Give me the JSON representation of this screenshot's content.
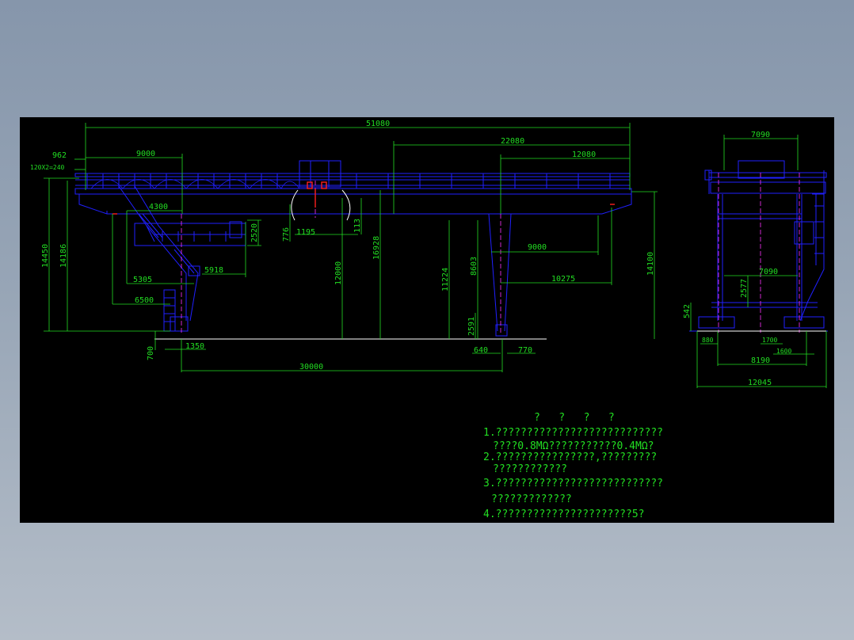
{
  "drawing": {
    "colors": {
      "structure": "#2020ff",
      "dimension": "#22dd22",
      "center_line": "#ff33ff",
      "hook": "#ff2020",
      "ground": "#ffffff",
      "background": "#000000"
    },
    "front_view_dims": {
      "d51080": "51080",
      "d22080": "22080",
      "d12080": "12080",
      "d962": "962",
      "d9000_top": "9000",
      "d120x2": "120X2=240",
      "d4300": "4300",
      "d2520": "2520",
      "d776": "776",
      "d1195": "1195",
      "d113": "113",
      "d16928": "16928",
      "d12000": "12000",
      "d11224": "11224",
      "d8603": "8603",
      "d2591": "2591",
      "d9000_right": "9000",
      "d10275": "10275",
      "d14100": "14100",
      "d14450": "14450",
      "d14186": "14186",
      "d5305": "5305",
      "d5918": "5918",
      "d6500": "6500",
      "d700": "700",
      "d1350": "1350",
      "d640": "640",
      "d770": "770",
      "d30000": "30000"
    },
    "side_view_dims": {
      "d7090_top": "7090",
      "d7090_mid": "7090",
      "d2577": "2577",
      "d542": "542",
      "d880": "880",
      "d1700": "1700",
      "d1600": "1600",
      "d8190": "8190",
      "d12045": "12045"
    },
    "notes": {
      "title": "?   ?   ?   ?",
      "line1": "1.???????????????????????????",
      "line1b": "????0.8MΩ???????????0.4MΩ?",
      "line2": "2.????????????????,?????????",
      "line2b": "????????????",
      "line3": "3.???????????????????????????",
      "line3b": "?????????????",
      "line4": "4.??????????????????????5?"
    }
  }
}
